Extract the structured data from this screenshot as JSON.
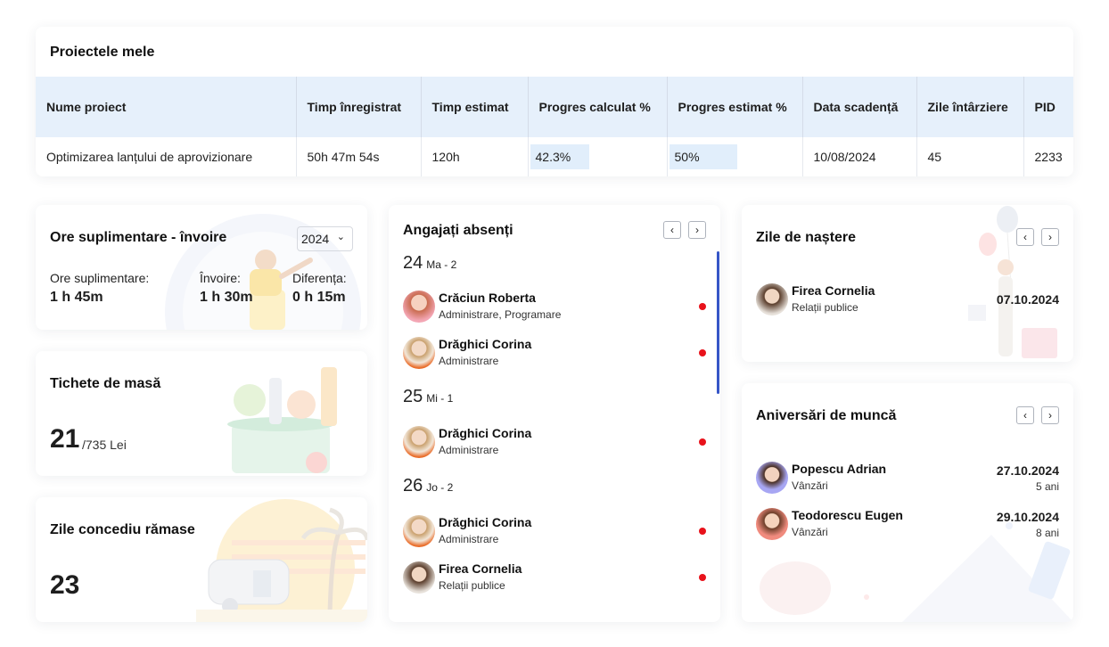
{
  "projects": {
    "title": "Proiectele mele",
    "columns": [
      "Nume proiect",
      "Timp înregistrat",
      "Timp estimat",
      "Progres calculat %",
      "Progres estimat %",
      "Data scadență",
      "Zile întârziere",
      "PID"
    ],
    "rows": [
      {
        "name": "Optimizarea lanțului de aprovizionare",
        "recorded": "50h 47m 54s",
        "estimated": "120h",
        "progress_calc": "42.3%",
        "progress_est": "50%",
        "due": "10/08/2024",
        "delay": "45",
        "pid": "2233"
      }
    ]
  },
  "overtime": {
    "title": "Ore suplimentare - învoire",
    "year": "2024",
    "stats": [
      {
        "label": "Ore suplimentare:",
        "value": "1 h 45m"
      },
      {
        "label": "Învoire:",
        "value": "1 h 30m"
      },
      {
        "label": "Diferența:",
        "value": "0 h 15m"
      }
    ]
  },
  "meal": {
    "title": "Tichete de masă",
    "count": "21",
    "sub": "/735 Lei"
  },
  "vacation": {
    "title": "Zile concediu rămase",
    "count": "23"
  },
  "absent": {
    "title": "Angajați absenți",
    "days": [
      {
        "day": "24",
        "label": "Ma - 2",
        "people": [
          {
            "name": "Crăciun Roberta",
            "role": "Administrare, Programare"
          },
          {
            "name": "Drăghici Corina",
            "role": "Administrare"
          }
        ]
      },
      {
        "day": "25",
        "label": "Mi - 1",
        "people": [
          {
            "name": "Drăghici Corina",
            "role": "Administrare"
          }
        ]
      },
      {
        "day": "26",
        "label": "Jo - 2",
        "people": [
          {
            "name": "Drăghici Corina",
            "role": "Administrare"
          },
          {
            "name": "Firea Cornelia",
            "role": "Relații publice"
          }
        ]
      }
    ]
  },
  "birthdays": {
    "title": "Zile de naștere",
    "people": [
      {
        "name": "Firea Cornelia",
        "role": "Relații publice",
        "date": "07.10.2024"
      }
    ]
  },
  "anniversaries": {
    "title": "Aniversări de muncă",
    "people": [
      {
        "name": "Popescu Adrian",
        "role": "Vânzări",
        "date": "27.10.2024",
        "years": "5 ani"
      },
      {
        "name": "Teodorescu Eugen",
        "role": "Vânzări",
        "date": "29.10.2024",
        "years": "8 ani"
      }
    ]
  },
  "nav": {
    "prev": "‹",
    "next": "›"
  },
  "colors": {
    "accent": "#3656c7",
    "table_header": "#e6f0fb",
    "absence_dot": "#e8121b"
  }
}
